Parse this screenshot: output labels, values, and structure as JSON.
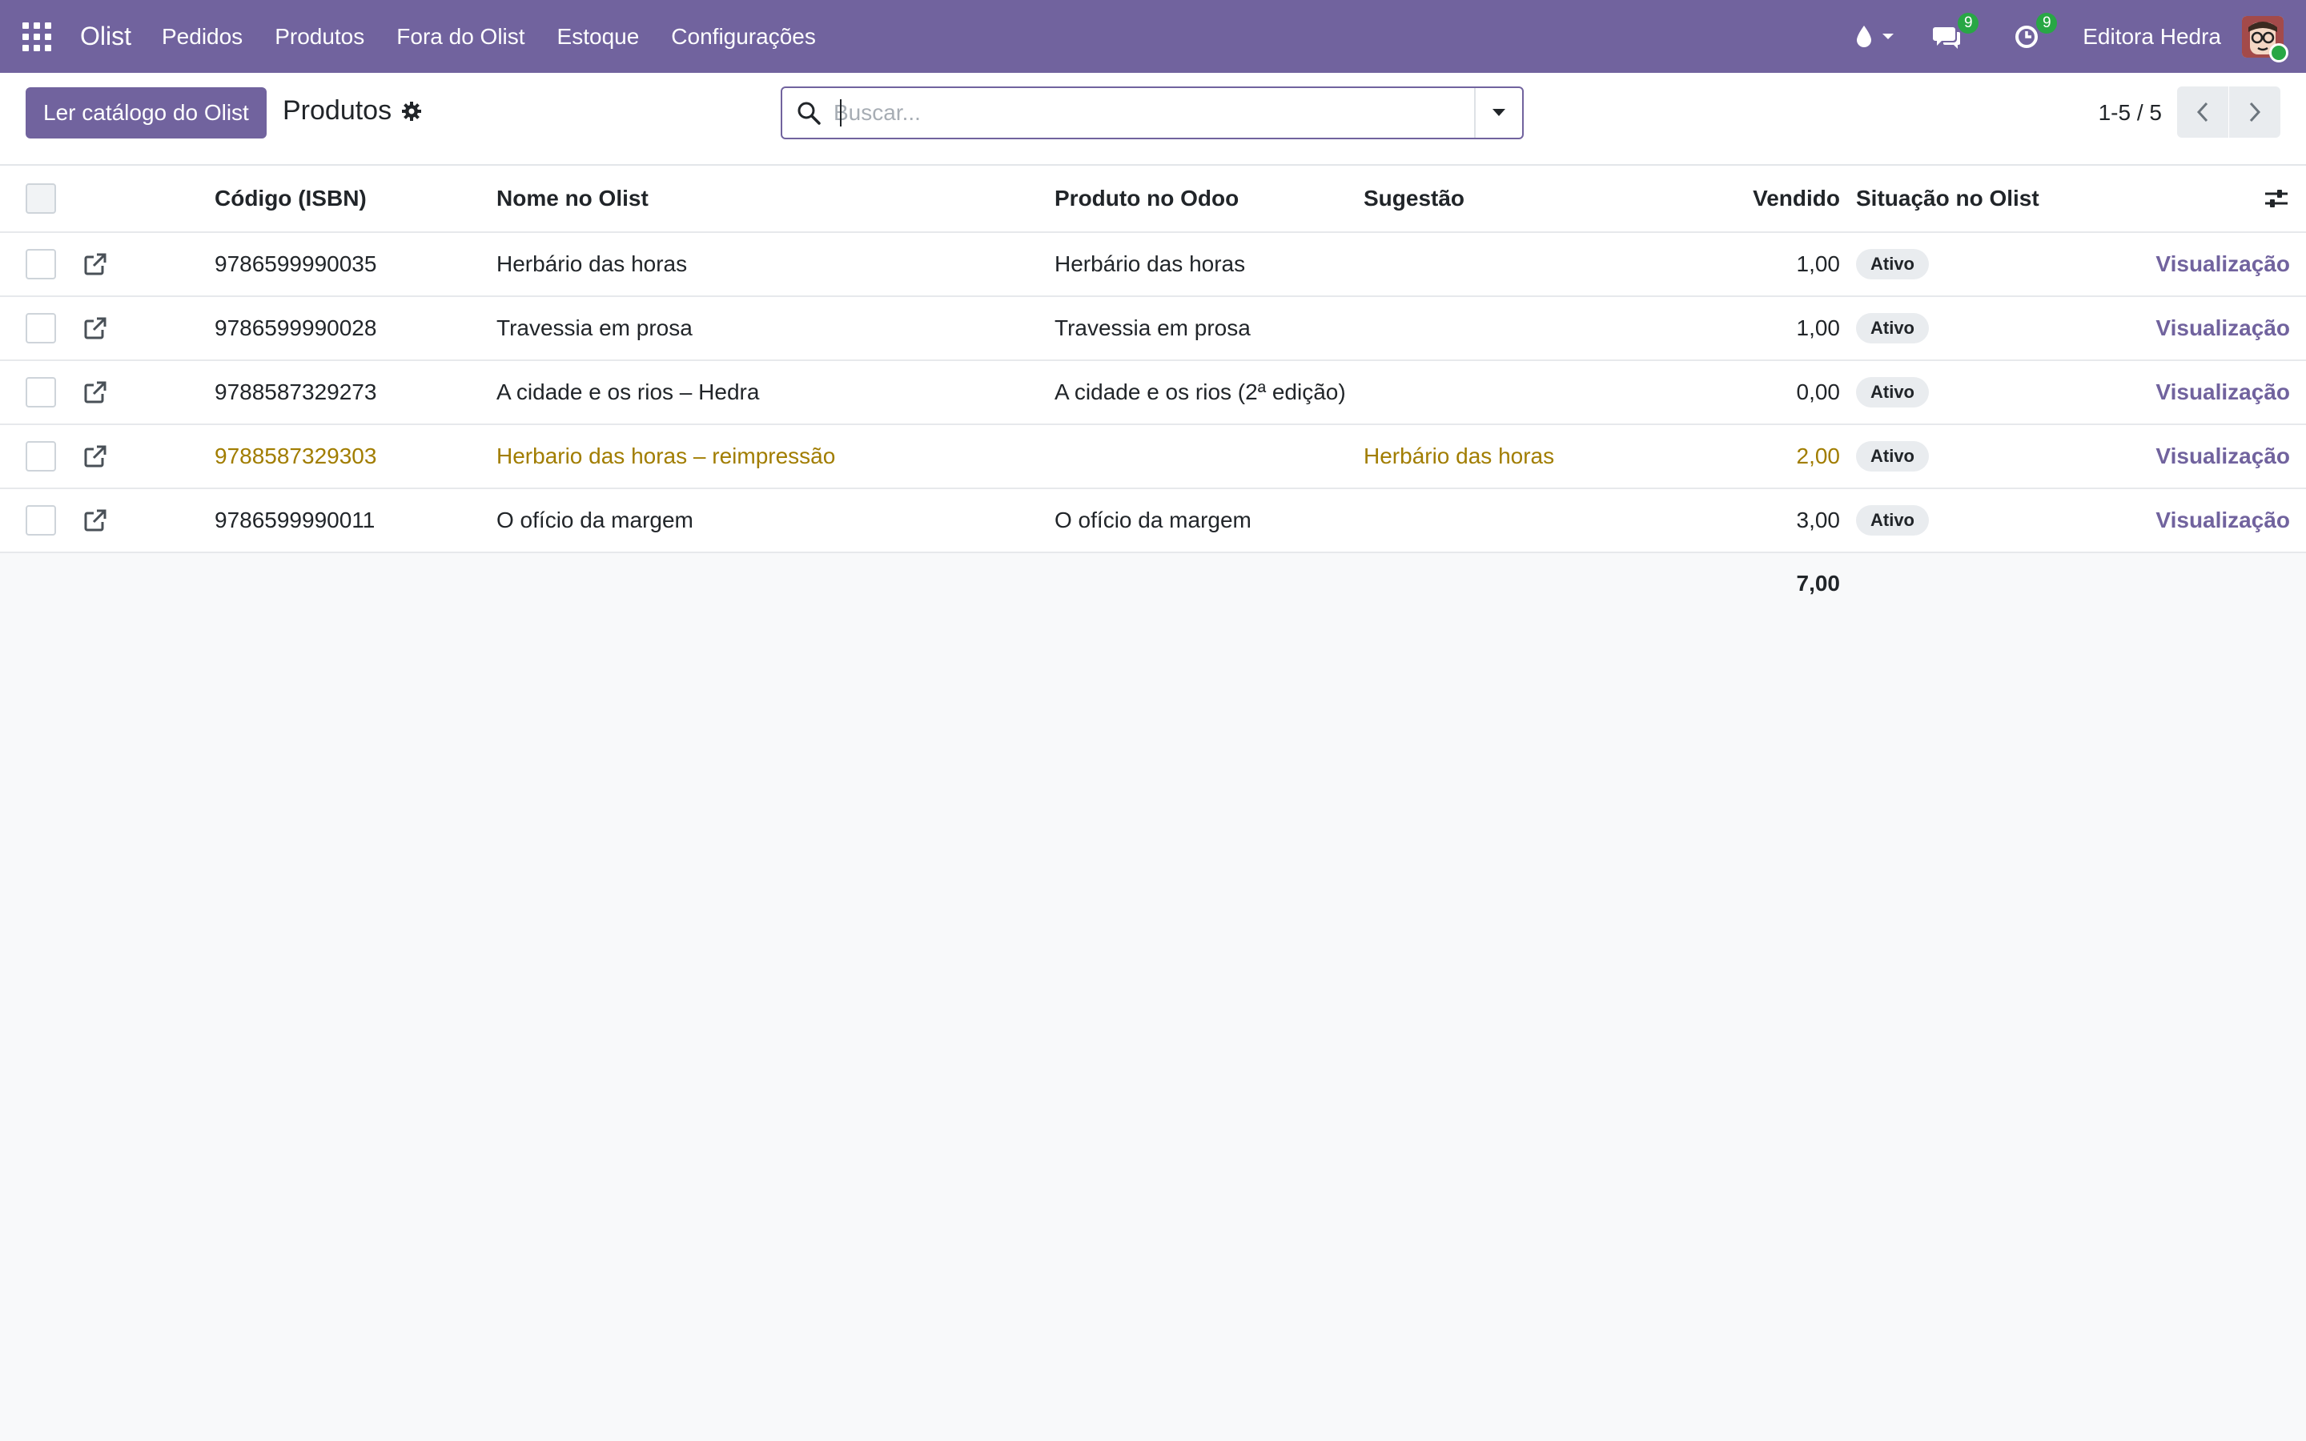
{
  "navbar": {
    "brand": "Olist",
    "menu": [
      "Pedidos",
      "Produtos",
      "Fora do Olist",
      "Estoque",
      "Configurações"
    ],
    "messages_count": "9",
    "activities_count": "9",
    "company": "Editora Hedra"
  },
  "control": {
    "primary_button": "Ler catálogo do Olist",
    "breadcrumb": "Produtos",
    "search_placeholder": "Buscar...",
    "pager": "1-5 / 5"
  },
  "table": {
    "headers": {
      "code": "Código (ISBN)",
      "name": "Nome no Olist",
      "product": "Produto no Odoo",
      "suggestion": "Sugestão",
      "sold": "Vendido",
      "status": "Situação no Olist"
    },
    "rows": [
      {
        "code": "9786599990035",
        "name": "Herbário das horas",
        "product": "Herbário das horas",
        "suggestion": "",
        "sold": "1,00",
        "status": "Ativo",
        "view": "Visualização"
      },
      {
        "code": "9786599990028",
        "name": "Travessia em prosa",
        "product": "Travessia em prosa",
        "suggestion": "",
        "sold": "1,00",
        "status": "Ativo",
        "view": "Visualização"
      },
      {
        "code": "9788587329273",
        "name": "A cidade e os rios – Hedra",
        "product": "A cidade e os rios (2ª edição)",
        "suggestion": "",
        "sold": "0,00",
        "status": "Ativo",
        "view": "Visualização"
      },
      {
        "code": "9788587329303",
        "name": "Herbario das horas – reimpressão",
        "product": "",
        "suggestion": "Herbário das horas",
        "sold": "2,00",
        "status": "Ativo",
        "view": "Visualização"
      },
      {
        "code": "9786599990011",
        "name": "O ofício da margem",
        "product": "O ofício da margem",
        "suggestion": "",
        "sold": "3,00",
        "status": "Ativo",
        "view": "Visualização"
      }
    ],
    "total_sold": "7,00"
  },
  "colors": {
    "brand": "#71639e",
    "warning_text": "#a17d00",
    "badge_green": "#28a745"
  }
}
